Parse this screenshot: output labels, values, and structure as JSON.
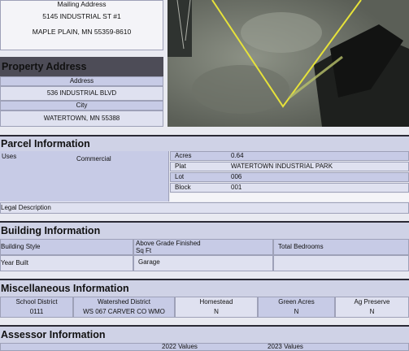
{
  "mailing": {
    "label": "Mailing Address",
    "street": "5145 INDUSTRIAL ST #1",
    "city": "MAPLE PLAIN, MN 55359-8610"
  },
  "property": {
    "title": "Property Address",
    "address_label": "Address",
    "address": "536 INDUSTRIAL BLVD",
    "city_label": "City",
    "city": "WATERTOWN, MN 55388"
  },
  "parcel": {
    "title": "Parcel Information",
    "uses_label": "Uses",
    "uses": "Commercial",
    "acres_label": "Acres",
    "acres": "0.64",
    "plat_label": "Plat",
    "plat": "WATERTOWN INDUSTRIAL PARK",
    "lot_label": "Lot",
    "lot": "006",
    "block_label": "Block",
    "block": "001",
    "legal_label": "Legal Description"
  },
  "building": {
    "title": "Building Information",
    "style_label": "Building Style",
    "above_grade_label": "Above Grade Finished Sq Ft",
    "bedrooms_label": "Total Bedrooms",
    "year_label": "Year Built",
    "garage_label": "Garage"
  },
  "misc": {
    "title": "Miscellaneous Information",
    "school_label": "School District",
    "school": "0111",
    "watershed_label": "Watershed District",
    "watershed": "WS 067 CARVER CO WMO",
    "homestead_label": "Homestead",
    "homestead": "N",
    "green_label": "Green Acres",
    "green": "N",
    "ag_label": "Ag Preserve",
    "ag": "N"
  },
  "assessor": {
    "title": "Assessor Information",
    "col1": "2022 Values",
    "col2": "2023 Values"
  },
  "colors": {
    "header_dark": "#4d4c57",
    "row_blue": "#c7cbe6",
    "map_line": "#e6e23a"
  }
}
